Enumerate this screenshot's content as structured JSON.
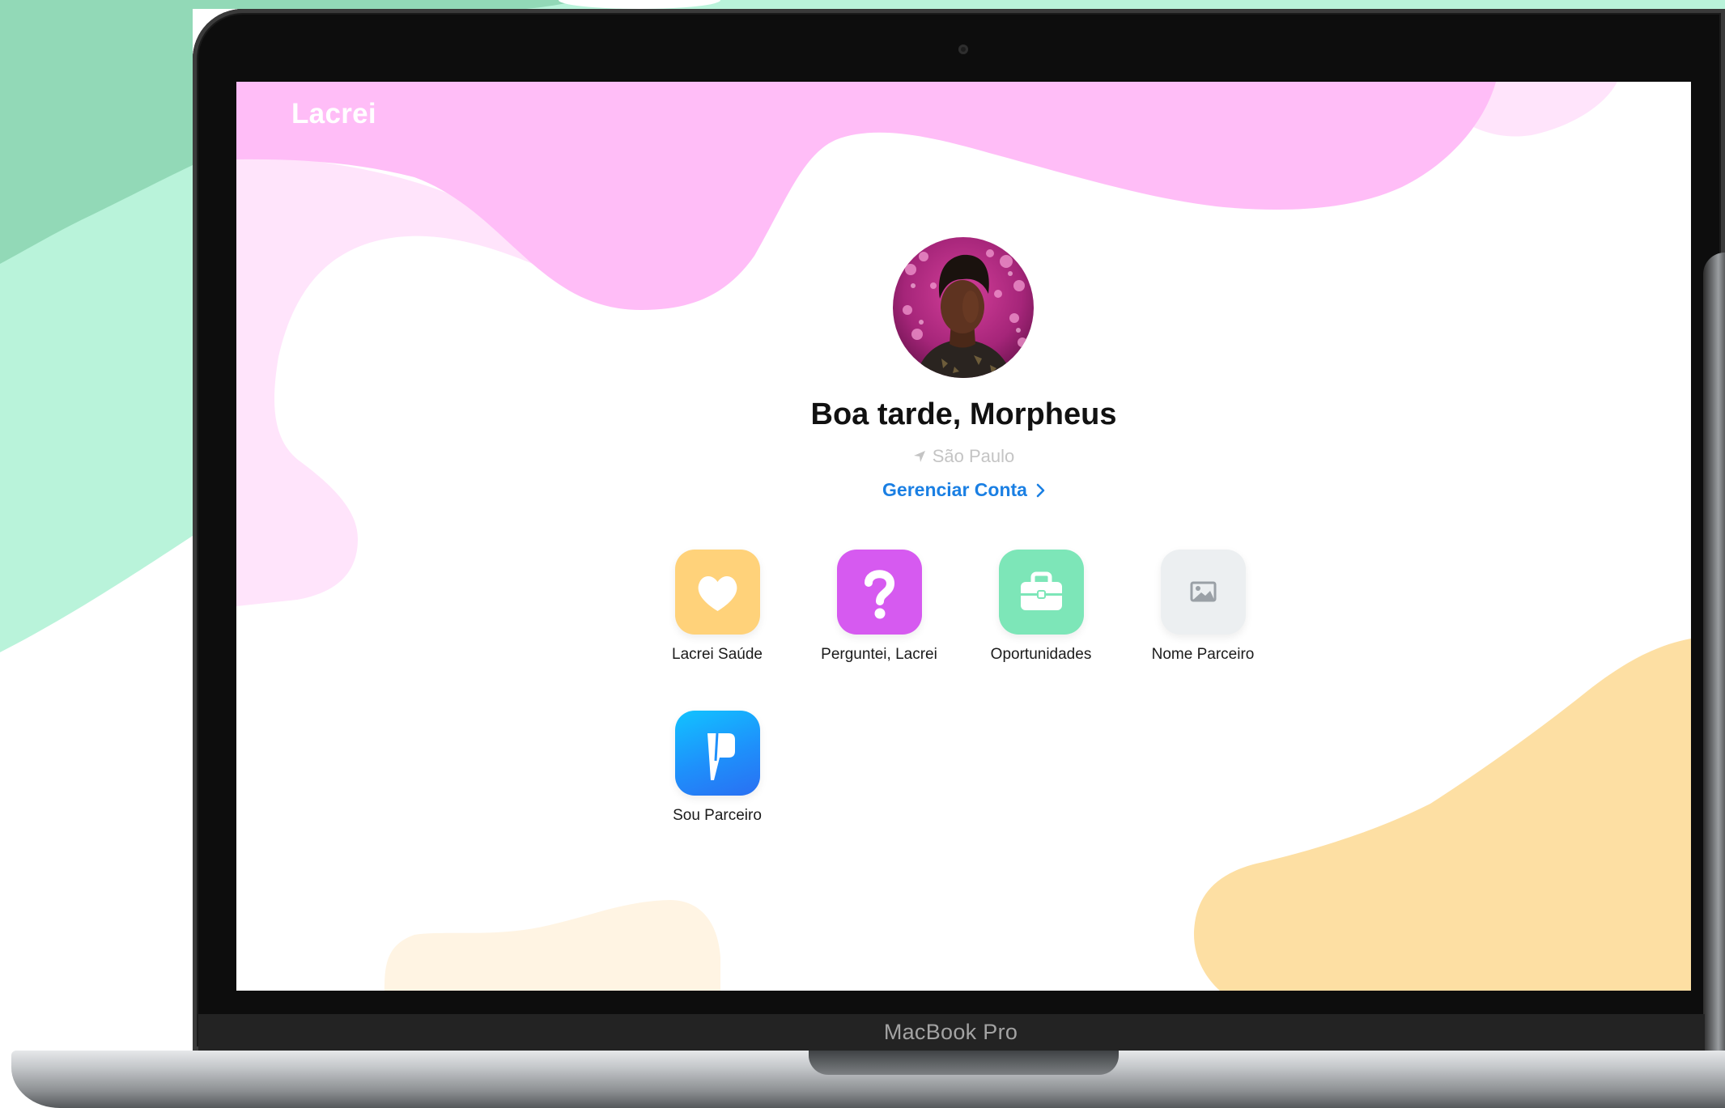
{
  "app": {
    "title": "Lacrei"
  },
  "profile": {
    "greeting": "Boa tarde, Morpheus",
    "location_icon": "navigation-arrow-icon",
    "location": "São Paulo",
    "manage_account": "Gerenciar Conta",
    "manage_account_icon": "chevron-right-icon"
  },
  "apps": [
    {
      "label": "Lacrei Saúde",
      "icon": "heart-icon",
      "color": "#FFD27A"
    },
    {
      "label": "Perguntei, Lacrei",
      "icon": "question-mark-icon",
      "color": "#D65AF0"
    },
    {
      "label": "Oportunidades",
      "icon": "briefcase-icon",
      "color": "#7DE6B8"
    },
    {
      "label": "Nome Parceiro",
      "icon": "image-placeholder-icon",
      "color": "#ECEFF1"
    },
    {
      "label": "Sou Parceiro",
      "icon": "partner-flag-icon",
      "color": "#1FA0FA"
    }
  ],
  "device": {
    "label": "MacBook Pro"
  },
  "colors": {
    "accent_link": "#1A7FE3",
    "blob_pink": "#FFBDF7",
    "blob_light_pink": "#FFE4FB",
    "blob_orange": "#FDDFA3",
    "background_mint": "#B9F3DA",
    "background_green": "#92D9B7"
  }
}
